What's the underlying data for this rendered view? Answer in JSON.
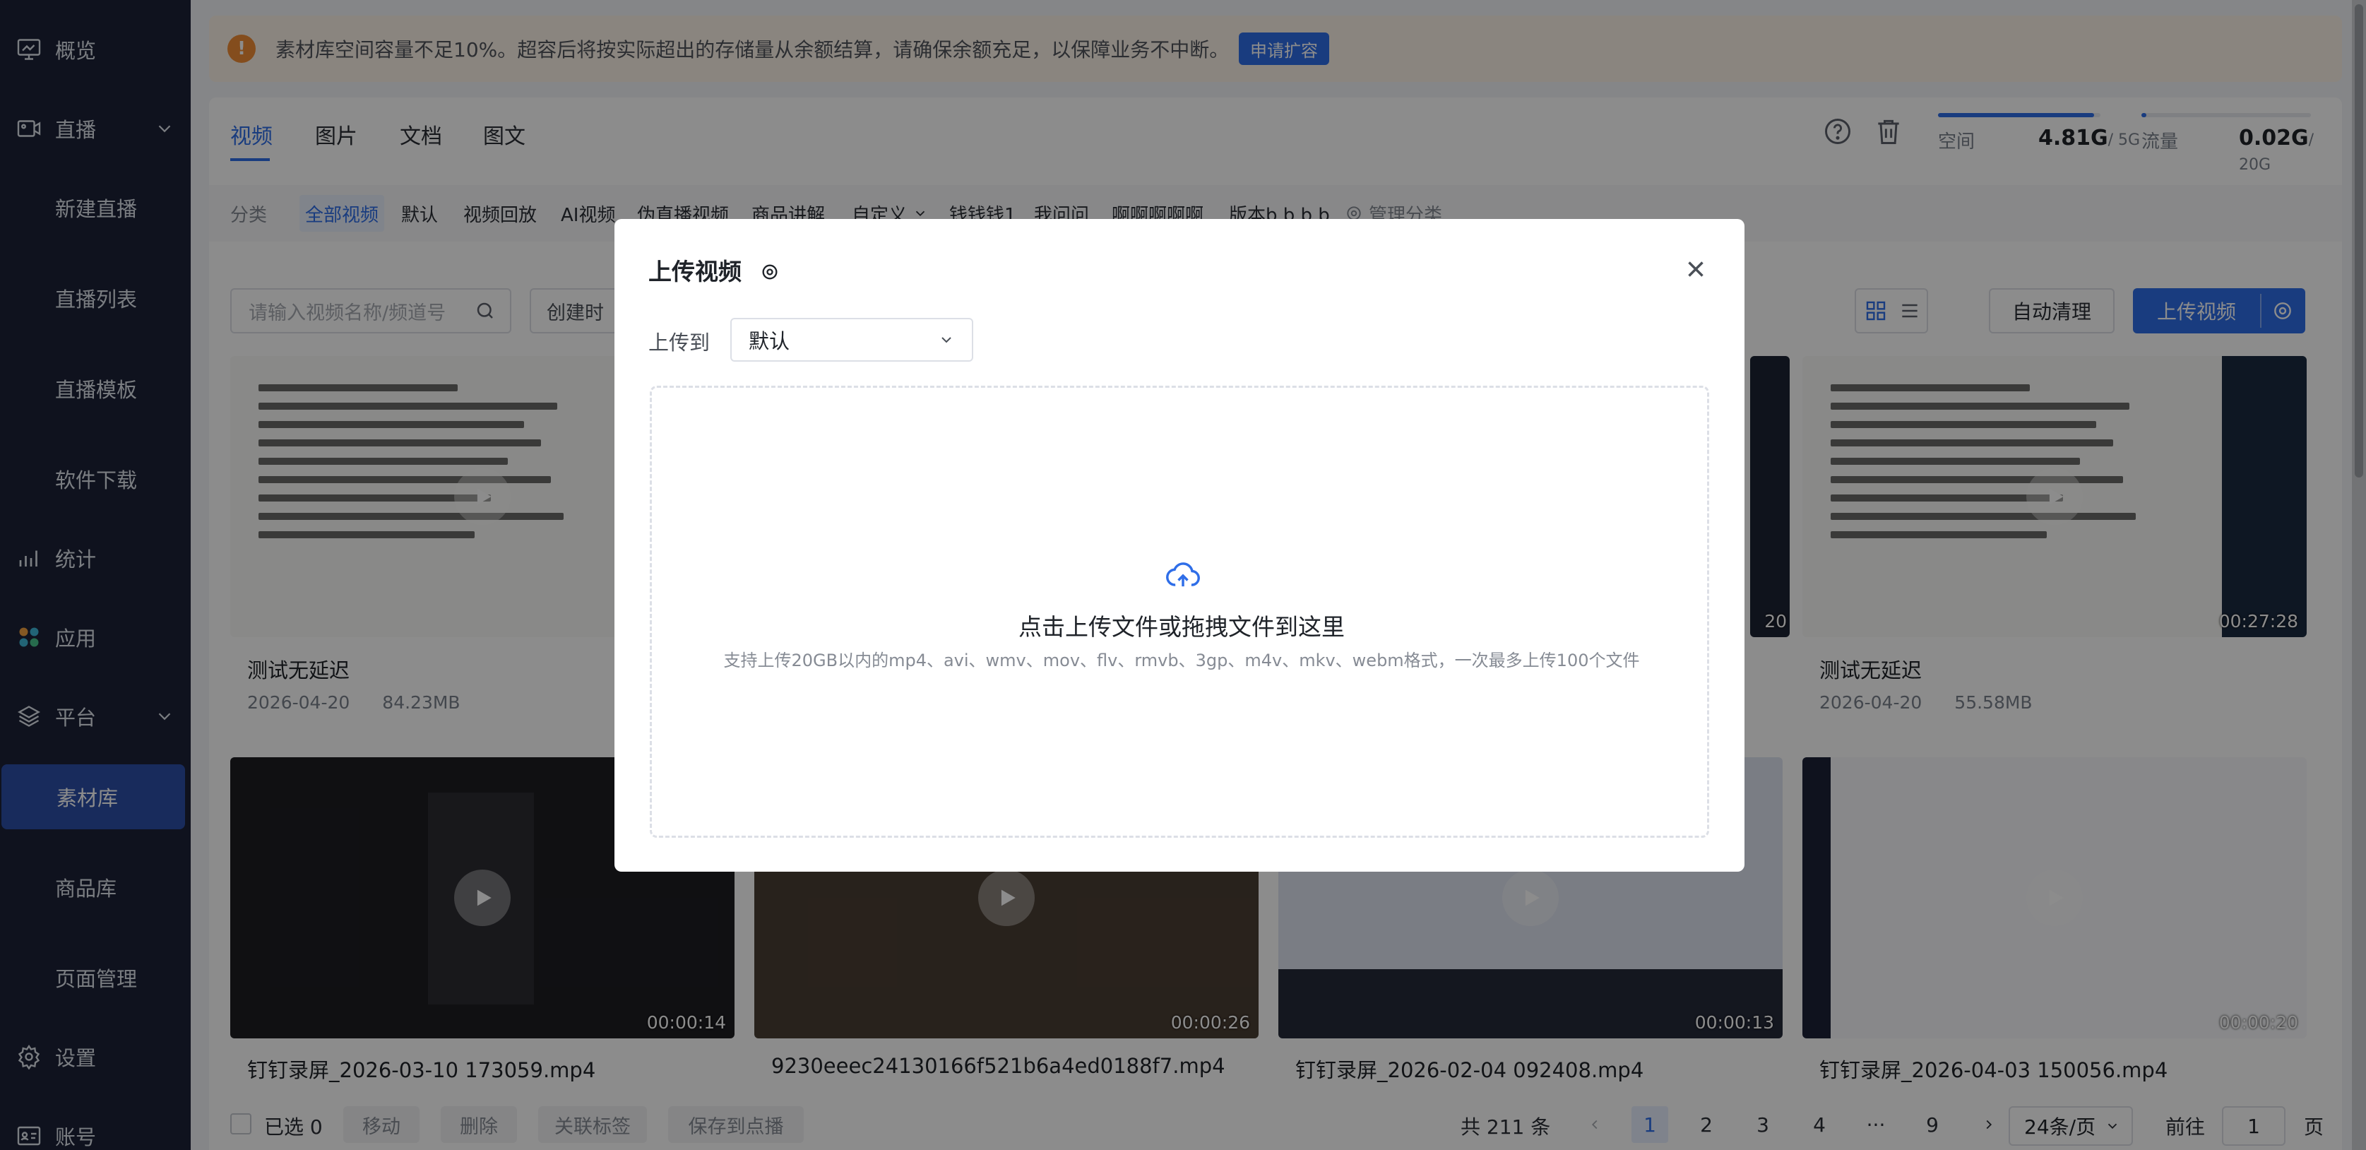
{
  "sidebar": {
    "items": [
      {
        "label": "概览",
        "icon": "monitor-icon"
      },
      {
        "label": "直播",
        "icon": "live-icon"
      },
      {
        "label": "新建直播"
      },
      {
        "label": "直播列表"
      },
      {
        "label": "直播模板"
      },
      {
        "label": "软件下载"
      },
      {
        "label": "统计",
        "icon": "bar-chart-icon"
      },
      {
        "label": "应用",
        "icon": "apps-icon"
      },
      {
        "label": "平台",
        "icon": "layers-icon"
      },
      {
        "label": "素材库"
      },
      {
        "label": "商品库"
      },
      {
        "label": "页面管理"
      },
      {
        "label": "设置",
        "icon": "gear-icon"
      },
      {
        "label": "账号",
        "icon": "id-card-icon"
      }
    ]
  },
  "alert": {
    "text": "素材库空间容量不足10%。超容后将按实际超出的存储量从余额结算，请确保余额充足，以保障业务不中断。",
    "button": "申请扩容"
  },
  "tabs": [
    "视频",
    "图片",
    "文档",
    "图文"
  ],
  "meters": {
    "space": {
      "label": "空间",
      "value": "4.81G",
      "total": "/ 5G",
      "fraction": 0.962
    },
    "traffic": {
      "label": "流量",
      "value": "0.02G",
      "total": "/ 20G",
      "fraction": 0.03
    }
  },
  "categories": {
    "label": "分类",
    "items": [
      "全部视频",
      "默认",
      "视频回放",
      "AI视频",
      "伪直播视频",
      "商品讲解",
      "自定义",
      "钱钱钱1",
      "我问问",
      "啊啊啊啊啊",
      "版本b b b b"
    ],
    "manage": "管理分类"
  },
  "toolbar": {
    "search_placeholder": "请输入视频名称/频道号",
    "date_label": "创建时",
    "auto_clean": "自动清理",
    "upload": "上传视频"
  },
  "cards": [
    {
      "title": "测试无延迟",
      "date": "2026-04-20",
      "size": "84.23MB"
    },
    {
      "title": "测试无延迟",
      "date": "2026-04-20",
      "size": "55.58MB",
      "duration": "00:27:28"
    },
    {
      "title": "钉钉录屏_2026-03-10 173059.mp4",
      "duration": "00:00:14"
    },
    {
      "title": "9230eeec24130166f521b6a4ed0188f7.mp4",
      "duration": "00:00:26"
    },
    {
      "title": "钉钉录屏_2026-02-04 092408.mp4",
      "duration": "00:00:13"
    },
    {
      "title": "钉钉录屏_2026-04-03 150056.mp4",
      "duration": "00:00:20"
    }
  ],
  "partial_duration": "20",
  "bottom": {
    "selected": "已选 0",
    "move": "移动",
    "delete": "删除",
    "tag": "关联标签",
    "save": "保存到点播",
    "total": "共 211 条",
    "pages": [
      "1",
      "2",
      "3",
      "4",
      "···",
      "9"
    ],
    "page_size": "24条/页",
    "goto": "前往",
    "goto_value": "1",
    "page_suffix": "页"
  },
  "modal": {
    "title": "上传视频",
    "upload_to_label": "上传到",
    "upload_to_value": "默认",
    "drop_main": "点击上传文件或拖拽文件到这里",
    "drop_hint": "支持上传20GB以内的mp4、avi、wmv、mov、flv、rmvb、3gp、m4v、mkv、webm格式，一次最多上传100个文件"
  },
  "colors": {
    "accent": "#2f6ee8",
    "sidebar": "#1c2238",
    "warning": "#f08c35"
  }
}
